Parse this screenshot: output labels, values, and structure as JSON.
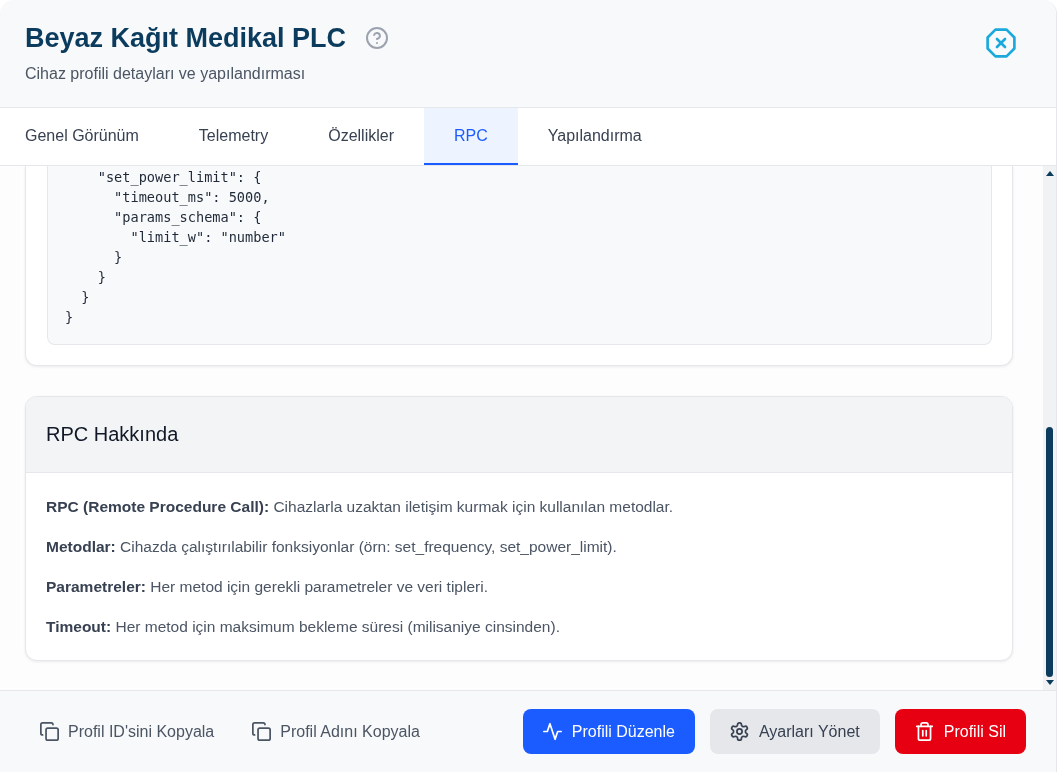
{
  "header": {
    "title": "Beyaz Kağıt Medikal PLC",
    "subtitle": "Cihaz profili detayları ve yapılandırması"
  },
  "tabs": [
    {
      "label": "Genel Görünüm",
      "selected": false
    },
    {
      "label": "Telemetry",
      "selected": false
    },
    {
      "label": "Özellikler",
      "selected": false
    },
    {
      "label": "RPC",
      "selected": true
    },
    {
      "label": "Yapılandırma",
      "selected": false
    }
  ],
  "rpc_schema": {
    "code": "    \"set_power_limit\": {\n      \"timeout_ms\": 5000,\n      \"params_schema\": {\n        \"limit_w\": \"number\"\n      }\n    }\n  }\n}"
  },
  "info_card": {
    "title": "RPC Hakkında",
    "paragraphs": [
      "**RPC (Remote Procedure Call):** Cihazlarla uzaktan iletişim kurmak için kullanılan metodlar.",
      "**Metodlar:** Cihazda çalıştırılabilir fonksiyonlar (örn: set_frequency, set_power_limit).",
      "**Parametreler:** Her metod için gerekli parametreler ve veri tipleri.",
      "**Timeout:** Her metod için maksimum bekleme süresi (milisaniye cinsinden)."
    ]
  },
  "footer": {
    "copy_links": [
      "Profil ID'sini Kopyala",
      "Profil Adını Kopyala"
    ],
    "buttons": [
      {
        "label": "Profili Düzenle",
        "kind": "primary"
      },
      {
        "label": "Ayarları Yönet",
        "kind": "secondary"
      },
      {
        "label": "Profili Sil",
        "kind": "danger"
      }
    ]
  }
}
